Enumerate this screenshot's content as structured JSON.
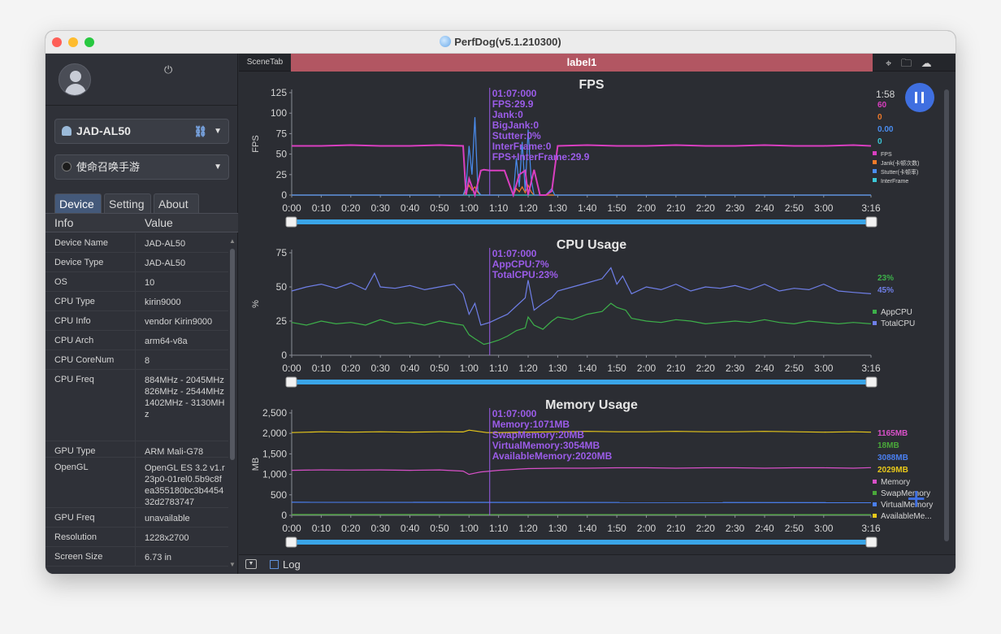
{
  "window": {
    "title": "PerfDog(v5.1.210300)"
  },
  "sidebar": {
    "device": "JAD-AL50",
    "game": "使命召唤手游",
    "tabs": [
      {
        "label": "Device"
      },
      {
        "label": "Setting"
      },
      {
        "label": "About"
      }
    ],
    "info_header": {
      "key": "Info",
      "value": "Value"
    },
    "info_rows": [
      {
        "key": "Device Name",
        "value": "JAD-AL50"
      },
      {
        "key": "Device Type",
        "value": "JAD-AL50"
      },
      {
        "key": "OS",
        "value": "10"
      },
      {
        "key": "CPU Type",
        "value": "kirin9000"
      },
      {
        "key": "CPU Info",
        "value": "vendor Kirin9000"
      },
      {
        "key": "CPU Arch",
        "value": "arm64-v8a"
      },
      {
        "key": "CPU CoreNum",
        "value": "8"
      },
      {
        "key": "CPU Freq",
        "value": "884MHz - 2045MHz 826MHz - 2544MHz 1402MHz - 3130MHz"
      },
      {
        "key": "GPU Type",
        "value": "ARM Mali-G78"
      },
      {
        "key": "OpenGL",
        "value": "OpenGL ES 3.2 v1.r23p0-01rel0.5b9c8fea355180bc3b445432d2783747"
      },
      {
        "key": "GPU Freq",
        "value": "unavailable"
      },
      {
        "key": "Resolution",
        "value": "1228x2700"
      },
      {
        "key": "Screen Size",
        "value": "6.73 in"
      }
    ]
  },
  "main": {
    "scene_tab": "SceneTab",
    "label": "label1",
    "elapsed": "1:58",
    "log_label": "Log",
    "x_ticks": [
      "0:00",
      "0:10",
      "0:20",
      "0:30",
      "0:40",
      "0:50",
      "1:00",
      "1:10",
      "1:20",
      "1:30",
      "1:40",
      "1:50",
      "2:00",
      "2:10",
      "2:20",
      "2:30",
      "2:40",
      "2:50",
      "3:00",
      "3:16"
    ]
  },
  "colors": {
    "fps": "#d93fc0",
    "jank": "#f07a2a",
    "stutter": "#4a8df0",
    "interframe": "#3cc8d8",
    "appcpu": "#3db04a",
    "totalcpu": "#6f7fe8",
    "memory": "#d850c8",
    "swap": "#4aa83a",
    "virtual": "#4a7ff0",
    "available": "#e8c81a",
    "cursor": "#9b5ce8",
    "accent": "#3f6fe0"
  },
  "chart_data": [
    {
      "type": "line",
      "title": "FPS",
      "ylabel": "FPS",
      "ylim": [
        0,
        125
      ],
      "yticks": [
        "0",
        "25",
        "50",
        "75",
        "100",
        "125"
      ],
      "cursor": {
        "time": "01:07:000",
        "lines": [
          "FPS:29.9",
          "Jank:0",
          "BigJank:0",
          "Stutter:0%",
          "InterFrame:0",
          "FPS+InterFrame:29.9"
        ]
      },
      "legend_values": [
        {
          "value": "60",
          "color": "#d93fc0"
        },
        {
          "value": "0",
          "color": "#f07a2a"
        },
        {
          "value": "0.00",
          "color": "#4a8df0"
        },
        {
          "value": "0",
          "color": "#3cc8d8"
        }
      ],
      "legend": [
        {
          "name": "FPS",
          "color": "#d93fc0"
        },
        {
          "name": "Jank(卡顿次数)",
          "color": "#f07a2a"
        },
        {
          "name": "Stutter(卡顿率)",
          "color": "#4a8df0"
        },
        {
          "name": "InterFrame",
          "color": "#3cc8d8"
        }
      ],
      "series": [
        {
          "name": "FPS",
          "x": [
            0,
            10,
            20,
            30,
            40,
            50,
            58,
            59,
            60,
            62,
            64,
            65,
            67,
            72,
            75,
            77,
            79,
            80,
            82,
            84,
            86,
            88,
            90,
            100,
            110,
            120,
            130,
            140,
            150,
            160,
            170,
            180,
            190,
            196
          ],
          "values": [
            60,
            60,
            61,
            60,
            60,
            61,
            60,
            0,
            20,
            0,
            30,
            31,
            30,
            30,
            0,
            25,
            30,
            0,
            31,
            0,
            0,
            5,
            60,
            61,
            60,
            60,
            61,
            60,
            60,
            61,
            60,
            60,
            61,
            60
          ]
        },
        {
          "name": "Stutter",
          "x": [
            0,
            58,
            59,
            60,
            61,
            62,
            63,
            64,
            65,
            72,
            75,
            76,
            77,
            78,
            79,
            80,
            81,
            82,
            84,
            86,
            88,
            89,
            90,
            196
          ],
          "values": [
            0,
            0,
            10,
            60,
            25,
            95,
            5,
            0,
            0,
            0,
            0,
            45,
            10,
            65,
            5,
            80,
            20,
            0,
            0,
            0,
            8,
            0,
            0,
            0
          ]
        },
        {
          "name": "Jank",
          "x": [
            0,
            58,
            59,
            60,
            61,
            62,
            63,
            64,
            72,
            75,
            76,
            77,
            78,
            79,
            80,
            81,
            82,
            84,
            196
          ],
          "values": [
            0,
            0,
            5,
            12,
            6,
            10,
            3,
            0,
            0,
            0,
            8,
            4,
            10,
            3,
            12,
            4,
            0,
            0,
            0
          ]
        },
        {
          "name": "InterFrame",
          "x": [
            0,
            196
          ],
          "values": [
            0,
            0
          ]
        }
      ]
    },
    {
      "type": "line",
      "title": "CPU Usage",
      "ylabel": "%",
      "ylim": [
        0,
        75
      ],
      "yticks": [
        "0",
        "25",
        "50",
        "75"
      ],
      "cursor": {
        "time": "01:07:000",
        "lines": [
          "AppCPU:7%",
          "TotalCPU:23%"
        ]
      },
      "legend_values": [
        {
          "value": "23%",
          "color": "#3db04a"
        },
        {
          "value": "45%",
          "color": "#6f7fe8"
        }
      ],
      "legend": [
        {
          "name": "AppCPU",
          "color": "#3db04a"
        },
        {
          "name": "TotalCPU",
          "color": "#6f7fe8"
        }
      ],
      "series": [
        {
          "name": "AppCPU",
          "x": [
            0,
            5,
            10,
            15,
            20,
            25,
            30,
            35,
            40,
            45,
            50,
            55,
            58,
            60,
            62,
            65,
            67,
            70,
            73,
            76,
            79,
            80,
            82,
            85,
            88,
            90,
            95,
            100,
            105,
            108,
            110,
            113,
            115,
            120,
            125,
            130,
            135,
            140,
            145,
            150,
            155,
            160,
            165,
            170,
            175,
            180,
            185,
            190,
            196
          ],
          "values": [
            24,
            22,
            25,
            23,
            24,
            22,
            26,
            23,
            24,
            22,
            25,
            23,
            22,
            15,
            12,
            8,
            9,
            11,
            14,
            18,
            20,
            28,
            22,
            19,
            25,
            28,
            26,
            30,
            32,
            38,
            35,
            33,
            27,
            25,
            24,
            26,
            25,
            23,
            24,
            25,
            24,
            26,
            24,
            23,
            25,
            24,
            23,
            24,
            23
          ]
        },
        {
          "name": "TotalCPU",
          "x": [
            0,
            5,
            10,
            15,
            20,
            25,
            28,
            30,
            35,
            40,
            45,
            50,
            55,
            58,
            60,
            62,
            64,
            67,
            70,
            73,
            76,
            79,
            80,
            82,
            85,
            88,
            90,
            95,
            100,
            105,
            108,
            110,
            112,
            115,
            120,
            125,
            130,
            135,
            140,
            145,
            150,
            155,
            160,
            165,
            170,
            175,
            180,
            185,
            190,
            196
          ],
          "values": [
            47,
            50,
            52,
            49,
            53,
            48,
            60,
            50,
            49,
            51,
            48,
            50,
            52,
            45,
            30,
            38,
            22,
            24,
            27,
            30,
            36,
            42,
            55,
            33,
            38,
            42,
            47,
            50,
            53,
            56,
            64,
            52,
            58,
            45,
            50,
            48,
            52,
            47,
            50,
            49,
            51,
            48,
            52,
            47,
            49,
            48,
            52,
            47,
            46,
            45
          ]
        }
      ]
    },
    {
      "type": "line",
      "title": "Memory Usage",
      "ylabel": "MB",
      "ylim": [
        0,
        2500
      ],
      "yticks": [
        "0",
        "500",
        "1,000",
        "1,500",
        "2,000",
        "2,500"
      ],
      "cursor": {
        "time": "01:07:000",
        "lines": [
          "Memory:1071MB",
          "SwapMemory:20MB",
          "VirtualMemory:3054MB",
          "AvailableMemory:2020MB"
        ]
      },
      "legend_values": [
        {
          "value": "1165MB",
          "color": "#d850c8"
        },
        {
          "value": "18MB",
          "color": "#4aa83a"
        },
        {
          "value": "3088MB",
          "color": "#4a7ff0"
        },
        {
          "value": "2029MB",
          "color": "#e8c81a"
        }
      ],
      "legend": [
        {
          "name": "Memory",
          "color": "#d850c8"
        },
        {
          "name": "SwapMemory",
          "color": "#4aa83a"
        },
        {
          "name": "VirtualMemory",
          "color": "#4a7ff0"
        },
        {
          "name": "AvailableMe...",
          "color": "#e8c81a"
        }
      ],
      "series": [
        {
          "name": "Memory",
          "x": [
            0,
            10,
            20,
            30,
            40,
            50,
            58,
            60,
            62,
            64,
            66,
            70,
            80,
            90,
            100,
            110,
            120,
            130,
            140,
            150,
            160,
            170,
            180,
            190,
            196
          ],
          "values": [
            1100,
            1110,
            1105,
            1110,
            1100,
            1110,
            1080,
            1000,
            1030,
            1060,
            1071,
            1100,
            1140,
            1150,
            1150,
            1160,
            1160,
            1150,
            1160,
            1160,
            1150,
            1160,
            1160,
            1150,
            1165
          ]
        },
        {
          "name": "SwapMemory",
          "x": [
            0,
            196
          ],
          "values": [
            20,
            18
          ]
        },
        {
          "name": "VirtualMemory",
          "x": [
            0,
            196
          ],
          "values": [
            320,
            310
          ]
        },
        {
          "name": "AvailableMemory",
          "x": [
            0,
            10,
            20,
            30,
            40,
            50,
            58,
            60,
            62,
            66,
            70,
            80,
            90,
            100,
            110,
            120,
            130,
            140,
            150,
            160,
            170,
            180,
            190,
            196
          ],
          "values": [
            2020,
            2040,
            2030,
            2040,
            2030,
            2040,
            2035,
            2080,
            2060,
            2020,
            2020,
            2030,
            2040,
            2050,
            2040,
            2040,
            2050,
            2040,
            2040,
            2050,
            2040,
            2030,
            2040,
            2029
          ]
        }
      ]
    }
  ]
}
